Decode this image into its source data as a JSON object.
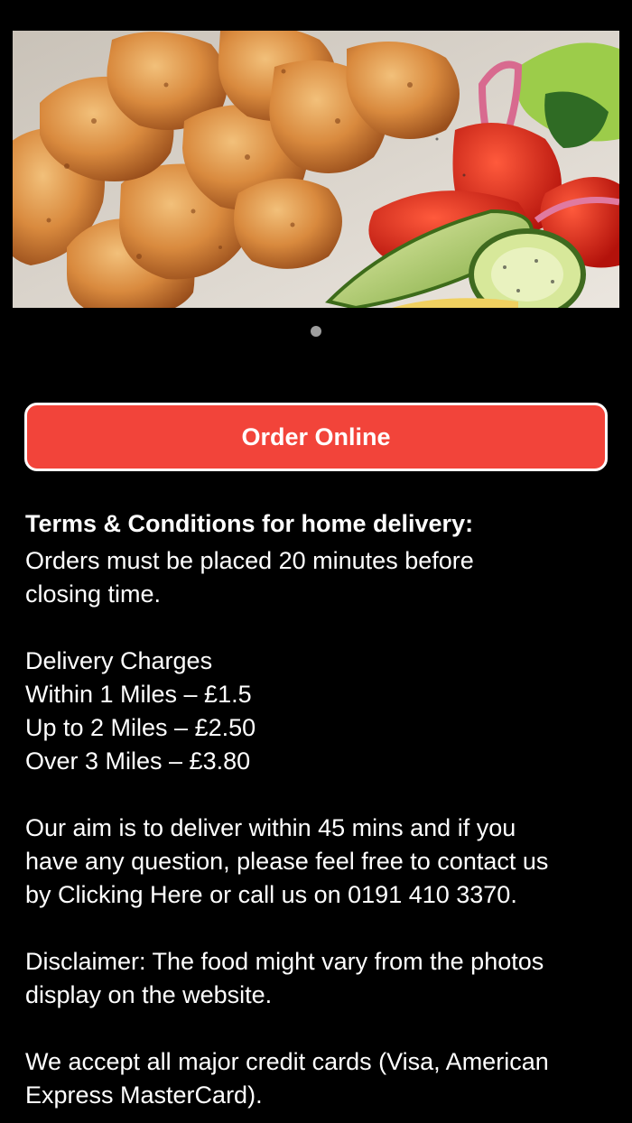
{
  "hero": {
    "image_alt": "Grilled chicken tikka pieces with tomato, onion and cucumber salad",
    "carousel_dots": 1,
    "active_dot": 1
  },
  "order_button": {
    "label": "Order Online",
    "color": "#f2443a"
  },
  "terms": {
    "heading": "Terms & Conditions for home delivery:",
    "line_orders_1": "Orders must be placed 20 minutes before",
    "line_orders_2": "closing time.",
    "delivery_title": "Delivery Charges",
    "delivery_1": "Within 1 Miles – £1.5",
    "delivery_2": "Up to 2 Miles – £2.50",
    "delivery_3": "Over 3 Miles – £3.80",
    "aim_1": "Our aim is to deliver within 45 mins and if you",
    "aim_2": "have any question, please feel free to contact us",
    "aim_3": "by Clicking Here or call us on 0191 410 3370.",
    "disclaimer_1": "Disclaimer: The food might vary from the photos",
    "disclaimer_2": "display on the website.",
    "cards_1": "We accept all major credit cards (Visa, American",
    "cards_2": "Express MasterCard)."
  }
}
